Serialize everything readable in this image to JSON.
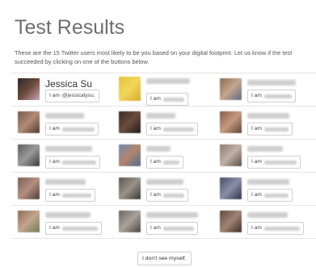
{
  "page": {
    "title": "Test Results",
    "intro": "These are the 15 Twitter users most likely to be you based on your digital footprint. Let us know if the test succeeded by clicking on one of the buttons below."
  },
  "results": [
    {
      "name": "Jessica Su",
      "button_prefix": "I am",
      "button_handle": "@jessicatysu.",
      "avatar_colors": [
        "#2b2b2b",
        "#6c4a3b",
        "#c9a5b3"
      ]
    },
    {
      "name": "",
      "button_prefix": "I am",
      "button_handle": "",
      "avatar_colors": [
        "#e8c13a",
        "#f1d85a",
        "#d9a827"
      ]
    },
    {
      "name": "",
      "button_prefix": "I am",
      "button_handle": "",
      "avatar_colors": [
        "#8a6b55",
        "#c5a58d",
        "#5b6d86"
      ]
    },
    {
      "name": "",
      "button_prefix": "I am",
      "button_handle": "",
      "avatar_colors": [
        "#7a5b4b",
        "#b08b76",
        "#4d3a33"
      ]
    },
    {
      "name": "",
      "button_prefix": "I am",
      "button_handle": "",
      "avatar_colors": [
        "#3b2a24",
        "#6a4d3f",
        "#1f1a18"
      ]
    },
    {
      "name": "",
      "button_prefix": "I am",
      "button_handle": "",
      "avatar_colors": [
        "#8a5a4a",
        "#c69a7f",
        "#5e4338"
      ]
    },
    {
      "name": "",
      "button_prefix": "I am",
      "button_handle": "",
      "avatar_colors": [
        "#5a5a5a",
        "#9a9a9a",
        "#3a3a3a"
      ]
    },
    {
      "name": "",
      "button_prefix": "I am",
      "button_handle": "",
      "avatar_colors": [
        "#6d8bb5",
        "#b3856c",
        "#4d6a8f"
      ]
    },
    {
      "name": "",
      "button_prefix": "I am",
      "button_handle": "",
      "avatar_colors": [
        "#8a7a70",
        "#c2b1a5",
        "#5a4d45"
      ]
    },
    {
      "name": "",
      "button_prefix": "I am",
      "button_handle": "",
      "avatar_colors": [
        "#7a5d52",
        "#b58f80",
        "#4b3b35"
      ]
    },
    {
      "name": "",
      "button_prefix": "I am",
      "button_handle": "",
      "avatar_colors": [
        "#5a5550",
        "#9b938a",
        "#3a3530"
      ]
    },
    {
      "name": "",
      "button_prefix": "I am",
      "button_handle": "",
      "avatar_colors": [
        "#4a4f6a",
        "#8a8fa8",
        "#2f3345"
      ]
    },
    {
      "name": "",
      "button_prefix": "I am",
      "button_handle": "",
      "avatar_colors": [
        "#8a6b55",
        "#c5a58d",
        "#6d7a5a"
      ]
    },
    {
      "name": "",
      "button_prefix": "I am",
      "button_handle": "",
      "avatar_colors": [
        "#6a6560",
        "#a9a29a",
        "#4a4540"
      ]
    },
    {
      "name": "",
      "button_prefix": "I am",
      "button_handle": "",
      "avatar_colors": [
        "#5e4a40",
        "#a08372",
        "#3d2f29"
      ]
    }
  ],
  "footer": {
    "no_match_label": "I don't see myself."
  }
}
